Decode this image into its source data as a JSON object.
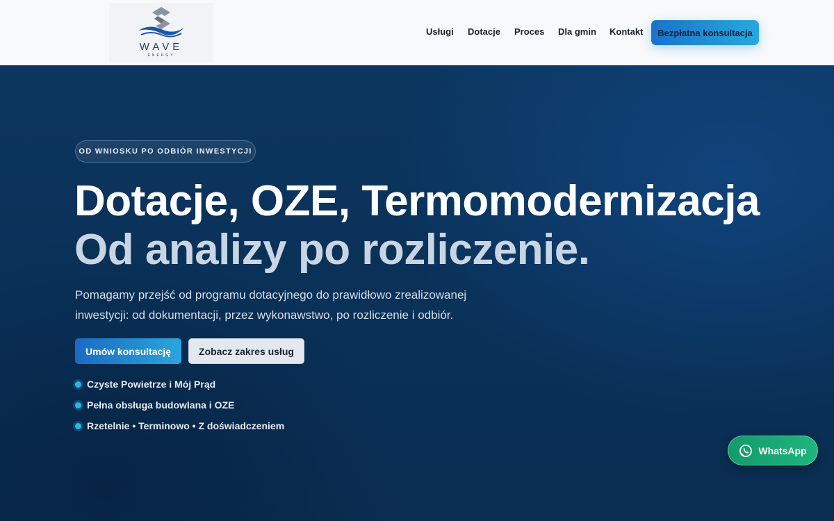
{
  "header": {
    "logo_text": "WAVE",
    "logo_sub": "ENERGY",
    "nav": [
      "Usługi",
      "Dotacje",
      "Proces",
      "Dla gmin",
      "Kontakt"
    ],
    "cta": "Bezpłatna konsultacja"
  },
  "hero": {
    "badge": "OD WNIOSKU PO ODBIÓR INWESTYCJI",
    "title_line1": "Dotacje, OZE, Termomodernizacja",
    "title_line2": "Od analizy po rozliczenie.",
    "lead": "Pomagamy przejść od programu dotacyjnego do prawidłowo zrealizowanej inwestycji: od dokumentacji, przez wykonawstwo, po rozliczenie i odbiór.",
    "primary_button": "Umów konsultację",
    "secondary_button": "Zobacz zakres usług",
    "features": [
      "Czyste Powietrze i Mój Prąd",
      "Pełna obsługa budowlana i OZE",
      "Rzetelnie • Terminowo • Z doświadczeniem"
    ]
  },
  "whatsapp": {
    "label": "WhatsApp"
  },
  "colors": {
    "accent": "#27a9dd",
    "hero_bg": "#0b3461",
    "whatsapp": "#1fb57d"
  }
}
